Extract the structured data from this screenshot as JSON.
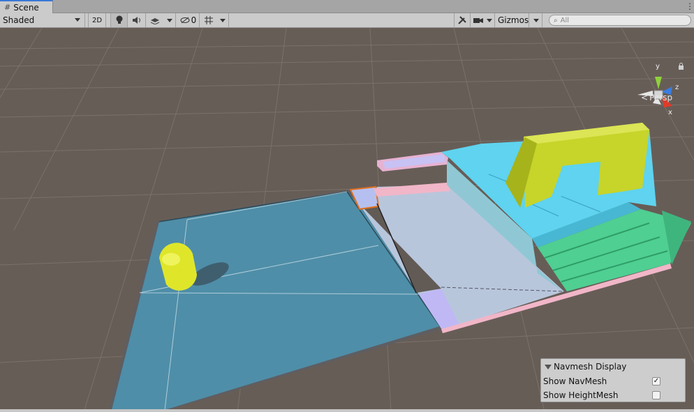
{
  "tab": {
    "icon": "grid-hash-icon",
    "label": "Scene"
  },
  "toolbar": {
    "shading_mode": "Shaded",
    "mode_2d": "2D",
    "hidden_count": "0",
    "gizmos_label": "Gizmos",
    "search_placeholder": "All"
  },
  "gizmo": {
    "axis_y": "y",
    "axis_z": "z",
    "axis_x": "x",
    "projection": "Persp",
    "colors": {
      "y": "#8fd13a",
      "z": "#3a7de0",
      "x": "#e03a2a"
    }
  },
  "navmesh_panel": {
    "title": "Navmesh Display",
    "show_navmesh_label": "Show NavMesh",
    "show_navmesh_checked": true,
    "show_heightmesh_label": "Show HeightMesh",
    "show_heightmesh_checked": false
  },
  "scene_colors": {
    "background": "#675d57",
    "navmesh_blue": "#4f8ea8",
    "navmesh_light": "#b8c6dc",
    "cyan_stairs": "#5fd3ef",
    "yellow_arch": "#c7d42a",
    "green_stairs": "#4fcf92",
    "capsule": "#e4ec2a",
    "pink_edge": "#f1b6c8",
    "orange_link": "#e0701e"
  }
}
